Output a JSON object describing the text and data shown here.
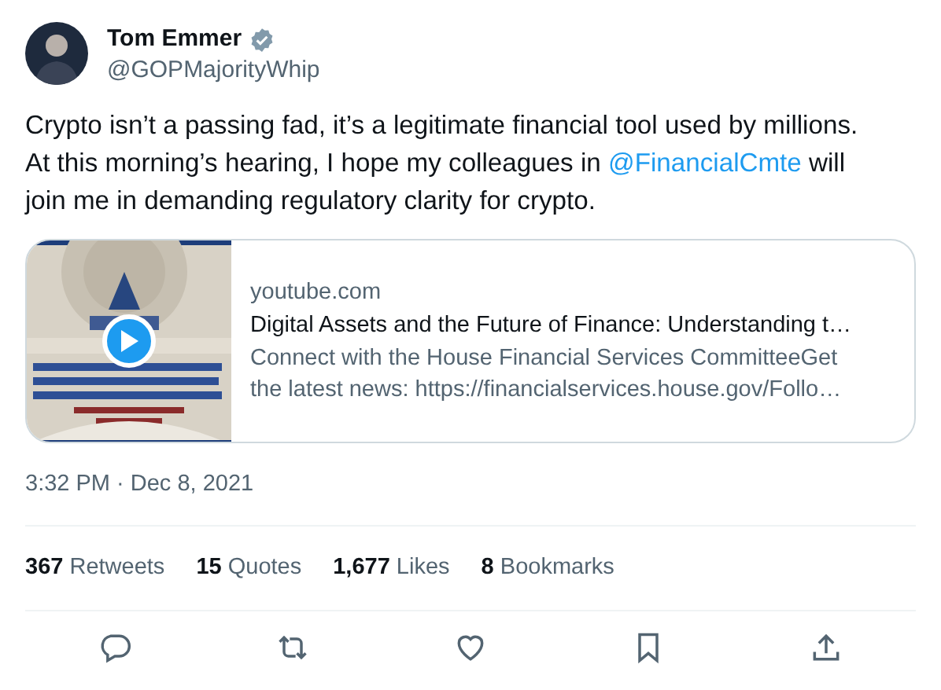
{
  "author": {
    "name": "Tom Emmer",
    "verified": true,
    "handle": "@GOPMajorityWhip"
  },
  "body": {
    "before": "Crypto isn’t a passing fad, it’s a legitimate financial tool used by millions. At this morning’s hearing, I hope my colleagues in ",
    "mention": "@FinancialCmte",
    "after": " will join me in demanding regulatory clarity for crypto."
  },
  "card": {
    "domain": "youtube.com",
    "title": "Digital Assets and the Future of Finance: Understanding t…",
    "description": "Connect with the House Financial Services CommitteeGet the latest news: https://financialservices.house.gov/Follo…"
  },
  "timestamp": "3:32 PM · Dec 8, 2021",
  "stats": [
    {
      "count": "367",
      "label": "Retweets"
    },
    {
      "count": "15",
      "label": "Quotes"
    },
    {
      "count": "1,677",
      "label": "Likes"
    },
    {
      "count": "8",
      "label": "Bookmarks"
    }
  ],
  "actions": [
    {
      "kind": "reply"
    },
    {
      "kind": "retweet"
    },
    {
      "kind": "like"
    },
    {
      "kind": "bookmark"
    },
    {
      "kind": "share"
    }
  ]
}
